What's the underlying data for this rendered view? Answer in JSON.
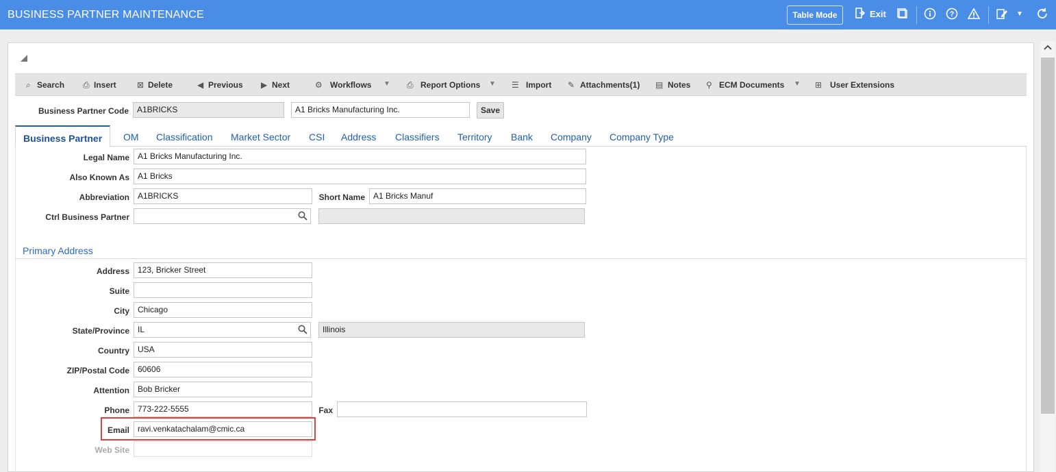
{
  "header": {
    "title": "BUSINESS PARTNER MAINTENANCE",
    "table_mode": "Table Mode",
    "exit": "Exit"
  },
  "toolbar": {
    "search": "Search",
    "insert": "Insert",
    "delete": "Delete",
    "previous": "Previous",
    "next": "Next",
    "workflows": "Workflows",
    "report_options": "Report Options",
    "import": "Import",
    "attachments": "Attachments(1)",
    "notes": "Notes",
    "ecm_documents": "ECM Documents",
    "user_extensions": "User Extensions"
  },
  "bp_code": {
    "label": "Business Partner Code",
    "code": "A1BRICKS",
    "name": "A1 Bricks Manufacturing Inc.",
    "save": "Save"
  },
  "tabs": [
    "Business Partner",
    "OM",
    "Classification",
    "Market Sector",
    "CSI",
    "Address",
    "Classifiers",
    "Territory",
    "Bank",
    "Company",
    "Company Type"
  ],
  "form": {
    "legal_name": {
      "label": "Legal Name",
      "value": "A1 Bricks Manufacturing Inc."
    },
    "also_known_as": {
      "label": "Also Known As",
      "value": "A1 Bricks"
    },
    "abbreviation": {
      "label": "Abbreviation",
      "value": "A1BRICKS"
    },
    "short_name": {
      "label": "Short Name",
      "value": "A1 Bricks Manuf"
    },
    "ctrl_bp": {
      "label": "Ctrl Business Partner",
      "value": "",
      "desc": ""
    }
  },
  "primary_address": {
    "title": "Primary Address",
    "address": {
      "label": "Address",
      "value": "123, Bricker Street"
    },
    "suite": {
      "label": "Suite",
      "value": ""
    },
    "city": {
      "label": "City",
      "value": "Chicago"
    },
    "state": {
      "label": "State/Province",
      "value": "IL",
      "desc": "Illinois"
    },
    "country": {
      "label": "Country",
      "value": "USA"
    },
    "zip": {
      "label": "ZIP/Postal Code",
      "value": "60606"
    },
    "attention": {
      "label": "Attention",
      "value": "Bob Bricker"
    },
    "phone": {
      "label": "Phone",
      "value": "773-222-5555"
    },
    "fax": {
      "label": "Fax",
      "value": ""
    },
    "email": {
      "label": "Email",
      "value": "ravi.venkatachalam@cmic.ca"
    },
    "web_site": {
      "label": "Web Site",
      "value": ""
    }
  },
  "icons": {
    "search": "magnifier-icon",
    "collapse": "collapse-triangle-icon"
  }
}
